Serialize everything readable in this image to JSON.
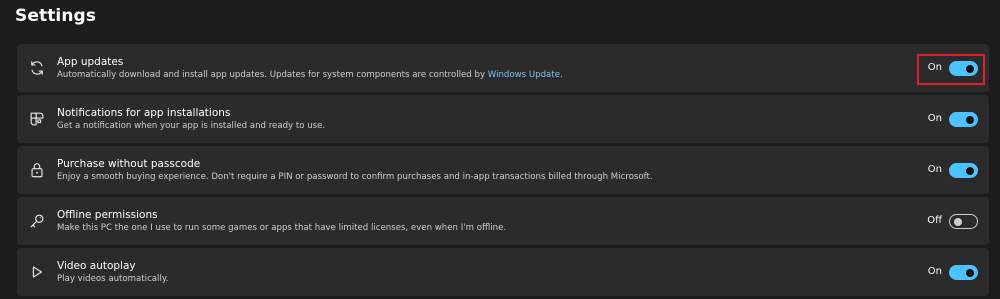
{
  "page": {
    "title": "Settings"
  },
  "settings": [
    {
      "icon": "sync-icon",
      "title": "App updates",
      "description": "Automatically download and install app updates. Updates for system components are controlled by ",
      "link": "Windows Update",
      "description_after": ".",
      "state_label": "On",
      "enabled": true,
      "highlighted": true
    },
    {
      "icon": "app-grid-icon",
      "title": "Notifications for app installations",
      "description": "Get a notification when your app is installed and ready to use.",
      "state_label": "On",
      "enabled": true
    },
    {
      "icon": "lock-icon",
      "title": "Purchase without passcode",
      "description": "Enjoy a smooth buying experience. Don't require a PIN or password to confirm purchases and in-app transactions billed through Microsoft.",
      "state_label": "On",
      "enabled": true
    },
    {
      "icon": "key-icon",
      "title": "Offline permissions",
      "description": "Make this PC the one I use to run some games or apps that have limited licenses, even when I'm offline.",
      "state_label": "Off",
      "enabled": false
    },
    {
      "icon": "play-icon",
      "title": "Video autoplay",
      "description": "Play videos automatically.",
      "state_label": "On",
      "enabled": true
    }
  ],
  "colors": {
    "accent": "#4cc2ff",
    "card_background": "#2b2b2b",
    "page_background": "#1c1c1c",
    "highlight": "#e0202b",
    "link": "#7ec4f2"
  }
}
